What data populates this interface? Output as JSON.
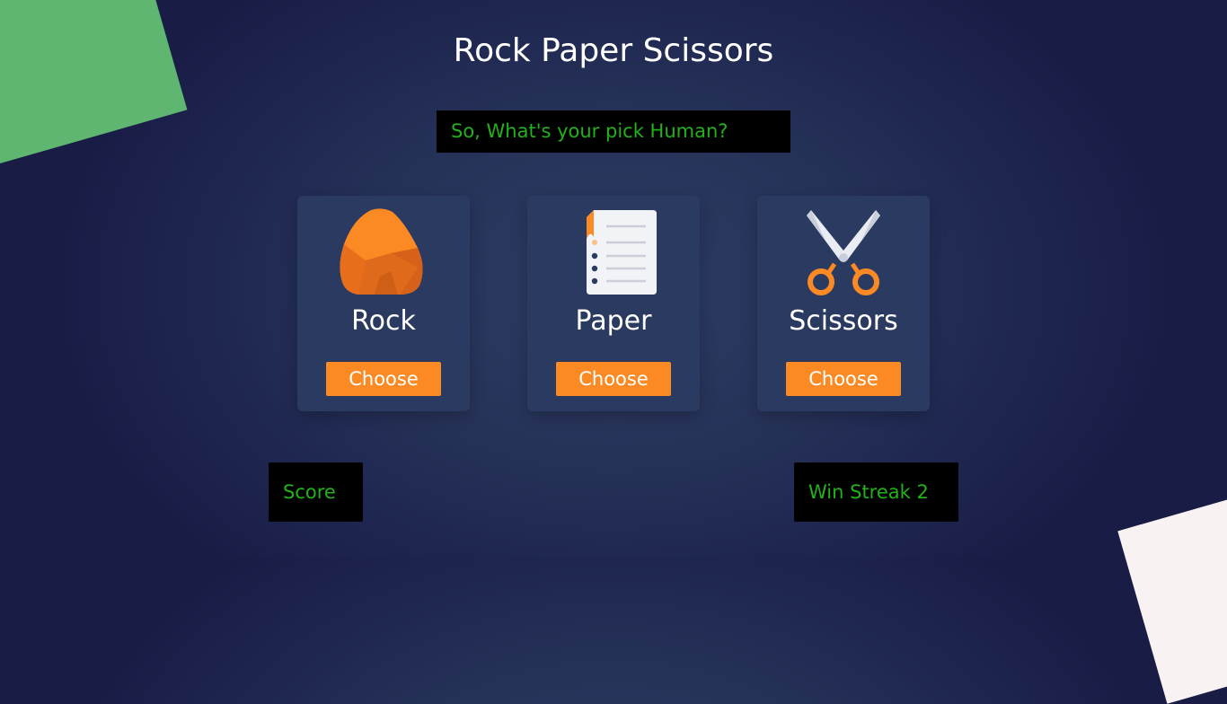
{
  "page": {
    "title": "Rock Paper Scissors",
    "prompt": "So, What's your pick Human?"
  },
  "choices": [
    {
      "label": "Rock",
      "icon": "rock-icon",
      "button_label": "Choose"
    },
    {
      "label": "Paper",
      "icon": "paper-icon",
      "button_label": "Choose"
    },
    {
      "label": "Scissors",
      "icon": "scissors-icon",
      "button_label": "Choose"
    }
  ],
  "stats": {
    "score_label": "Score",
    "win_streak_label": "Win Streak 2"
  },
  "colors": {
    "accent": "#fb8a24",
    "status_text": "#22b21a",
    "card_bg": "#2b3a60",
    "page_bg": "#1e2650",
    "decor_green": "#5fb670",
    "decor_light": "#f8f3f2"
  }
}
